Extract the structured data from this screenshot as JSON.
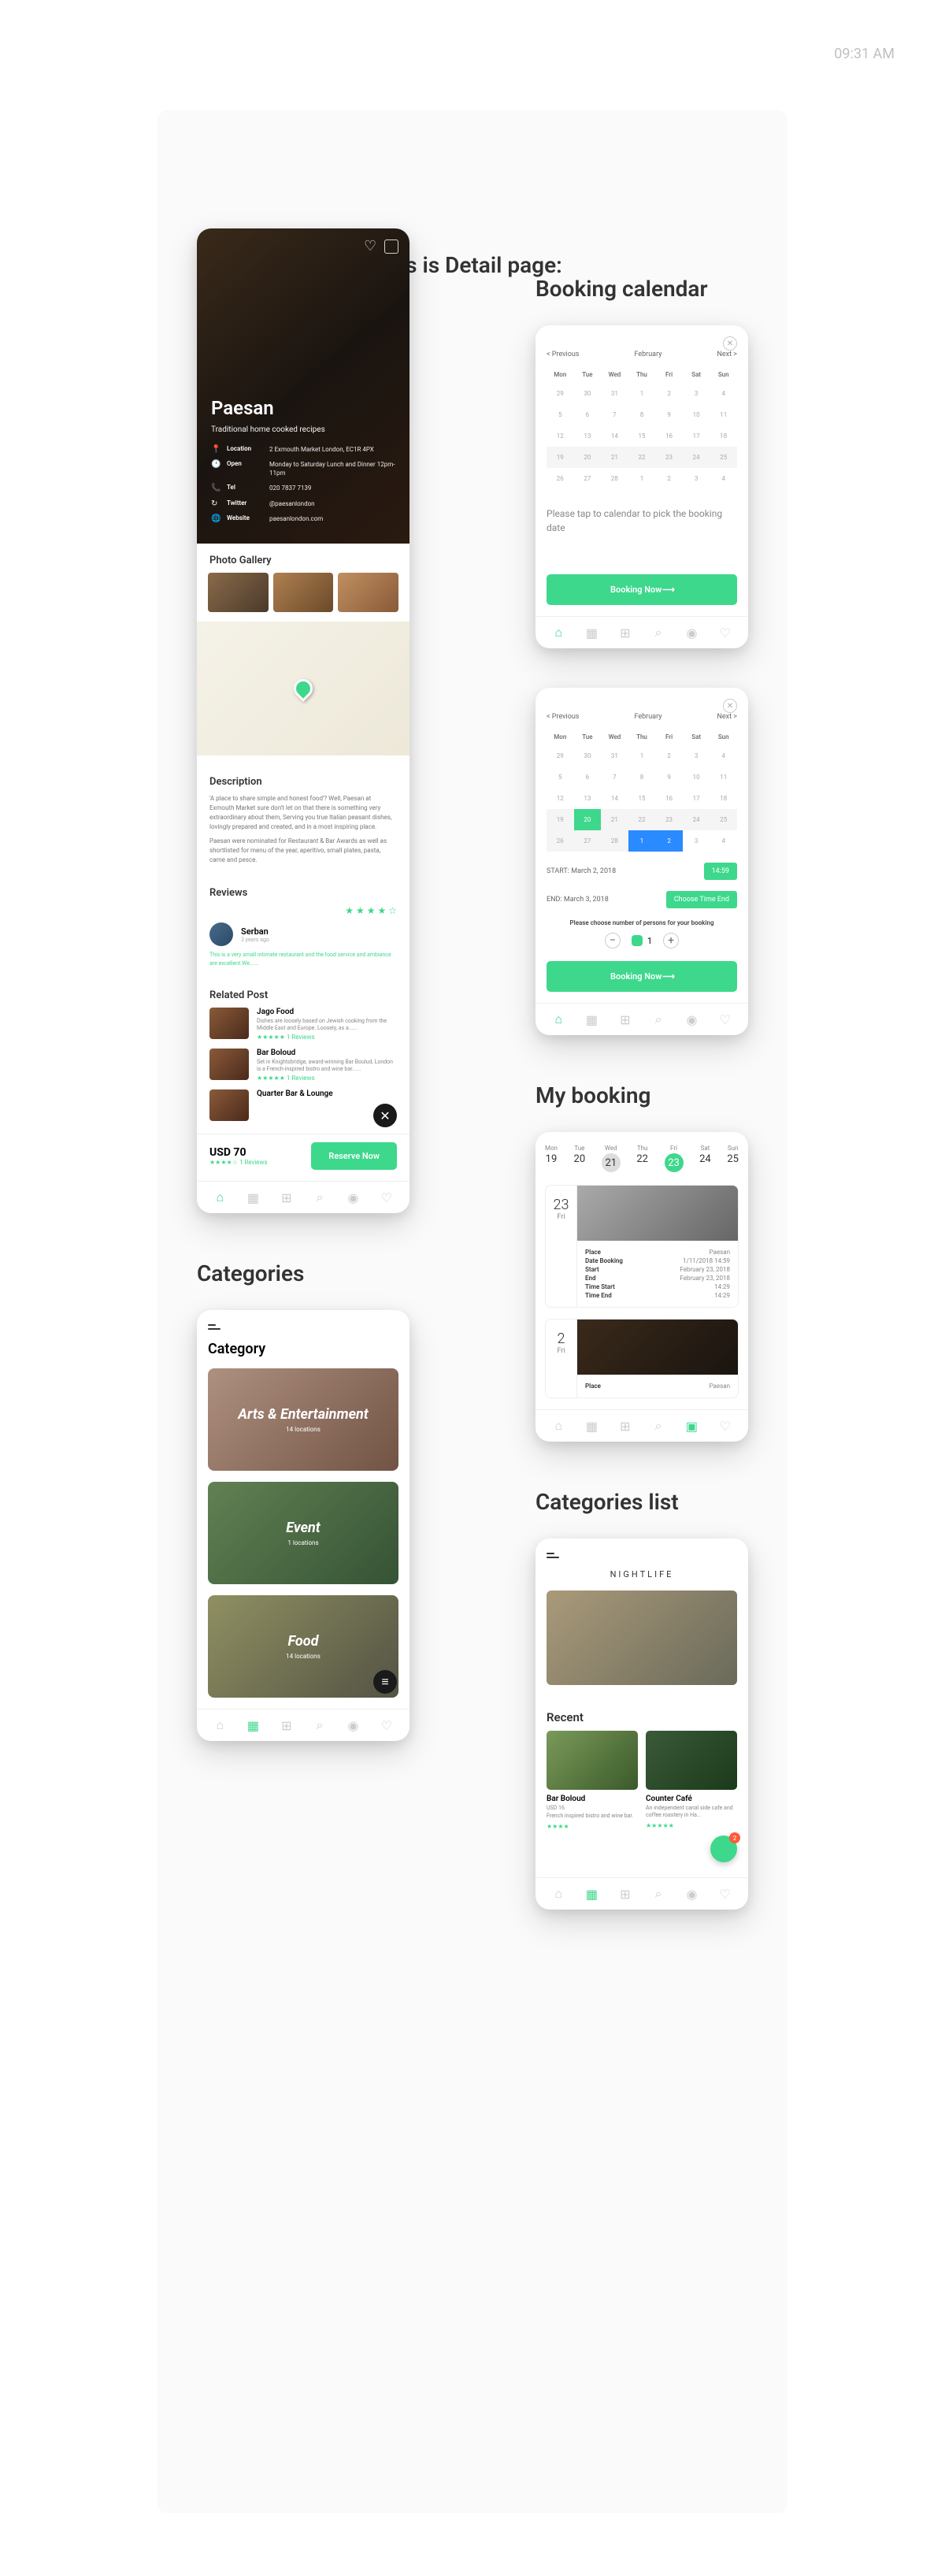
{
  "time": "09:31 AM",
  "pageTitle": "This is Detail page:",
  "detail": {
    "name": "Paesan",
    "subtitle": "Traditional home cooked recipes",
    "rows": [
      {
        "icon": "📍",
        "lab": "Location",
        "val": "2 Exmouth Market London, EC1R 4PX"
      },
      {
        "icon": "🕐",
        "lab": "Open",
        "val": "Monday to Saturday Lunch and Dinner 12pm-11pm"
      },
      {
        "icon": "📞",
        "lab": "Tel",
        "val": "020 7837 7139"
      },
      {
        "icon": "↻",
        "lab": "Twitter",
        "val": "@paesanlondon"
      },
      {
        "icon": "🌐",
        "lab": "Website",
        "val": "paesanlondon.com"
      }
    ],
    "galleryHead": "Photo Gallery",
    "descHead": "Description",
    "desc1": "'A place to share simple and honest food'? Well, Paesan at Exmouth Market sure don't let on that there is something very extraordinary about them, Serving you true Italian peasant dishes, lovingly prepared and created, and in a most inspiring place.",
    "desc2": "Paesan were nominated for Restaurant & Bar Awards as well as shortlisted for menu of the year, aperitivo, small plates, pasta, carne and pesce.",
    "reviewsHead": "Reviews",
    "reviewer": "Serban",
    "reviewAgo": "3 years ago",
    "reviewText": "This is a very small intimate restaurant and the food service and ambiance are excellent.We......",
    "relatedHead": "Related Post",
    "posts": [
      {
        "t": "Jago Food",
        "d": "Dishes are loosely based on Jewish cooking from the Middle East and Europe. Loosely, as a......",
        "r": "1 Reviews"
      },
      {
        "t": "Bar Boloud",
        "d": "Set in Knightsbridge, award-winning Bar Boulud, London is a French-inspired bistro and wine bar......",
        "r": "1 Reviews"
      },
      {
        "t": "Quarter Bar & Lounge",
        "d": "",
        "r": ""
      }
    ],
    "price": "USD 70",
    "priceReviews": "1 Reviews",
    "reserve": "Reserve Now"
  },
  "booking": {
    "sectionLabel": "Booking calendar",
    "prev": "< Previous",
    "month": "February",
    "next": "Next >",
    "days": [
      "Mon",
      "Tue",
      "Wed",
      "Thu",
      "Fri",
      "Sat",
      "Sun"
    ],
    "hint": "Please tap to calendar to pick the booking date",
    "btn": "Booking Now",
    "start": "START: March 2, 2018",
    "startTime": "14:59",
    "end": "END: March 3, 2018",
    "chooseEnd": "Choose Time End",
    "personsLab": "Please choose number of persons for your booking",
    "persons": "1"
  },
  "mybooking": {
    "sectionLabel": "My booking",
    "week": [
      {
        "d": "Mon",
        "n": "19"
      },
      {
        "d": "Tue",
        "n": "20"
      },
      {
        "d": "Wed",
        "n": "21"
      },
      {
        "d": "Thu",
        "n": "22"
      },
      {
        "d": "Fri",
        "n": "23"
      },
      {
        "d": "Sat",
        "n": "24"
      },
      {
        "d": "Sun",
        "n": "25"
      }
    ],
    "cards": [
      {
        "dn": "23",
        "dd": "Fri",
        "rows": [
          [
            "Place",
            "Paesan"
          ],
          [
            "Date Booking",
            "1/11/2018 14:59"
          ],
          [
            "Start",
            "February 23, 2018"
          ],
          [
            "End",
            "February 23, 2018"
          ],
          [
            "Time Start",
            "14:29"
          ],
          [
            "Time End",
            "14:29"
          ]
        ]
      },
      {
        "dn": "2",
        "dd": "Fri",
        "rows": [
          [
            "Place",
            "Paesan"
          ]
        ]
      }
    ]
  },
  "categories": {
    "sectionLabel": "Categories",
    "head": "Category",
    "items": [
      {
        "t": "Arts & Entertainment",
        "l": "14 locations"
      },
      {
        "t": "Event",
        "l": "1 locations"
      },
      {
        "t": "Food",
        "l": "14 locations"
      }
    ]
  },
  "catlist": {
    "sectionLabel": "Categories list",
    "title": "NIGHTLIFE",
    "recent": "Recent",
    "items": [
      {
        "t": "Bar Boloud",
        "s": "USD 16",
        "d": "French inspired bistro and wine bar.",
        "stars": "★★★★"
      },
      {
        "t": "Counter Café",
        "s": "",
        "d": "An independent canal side cafe and coffee roastery in Ha...",
        "stars": "★★★★★"
      }
    ],
    "badge": "2"
  }
}
